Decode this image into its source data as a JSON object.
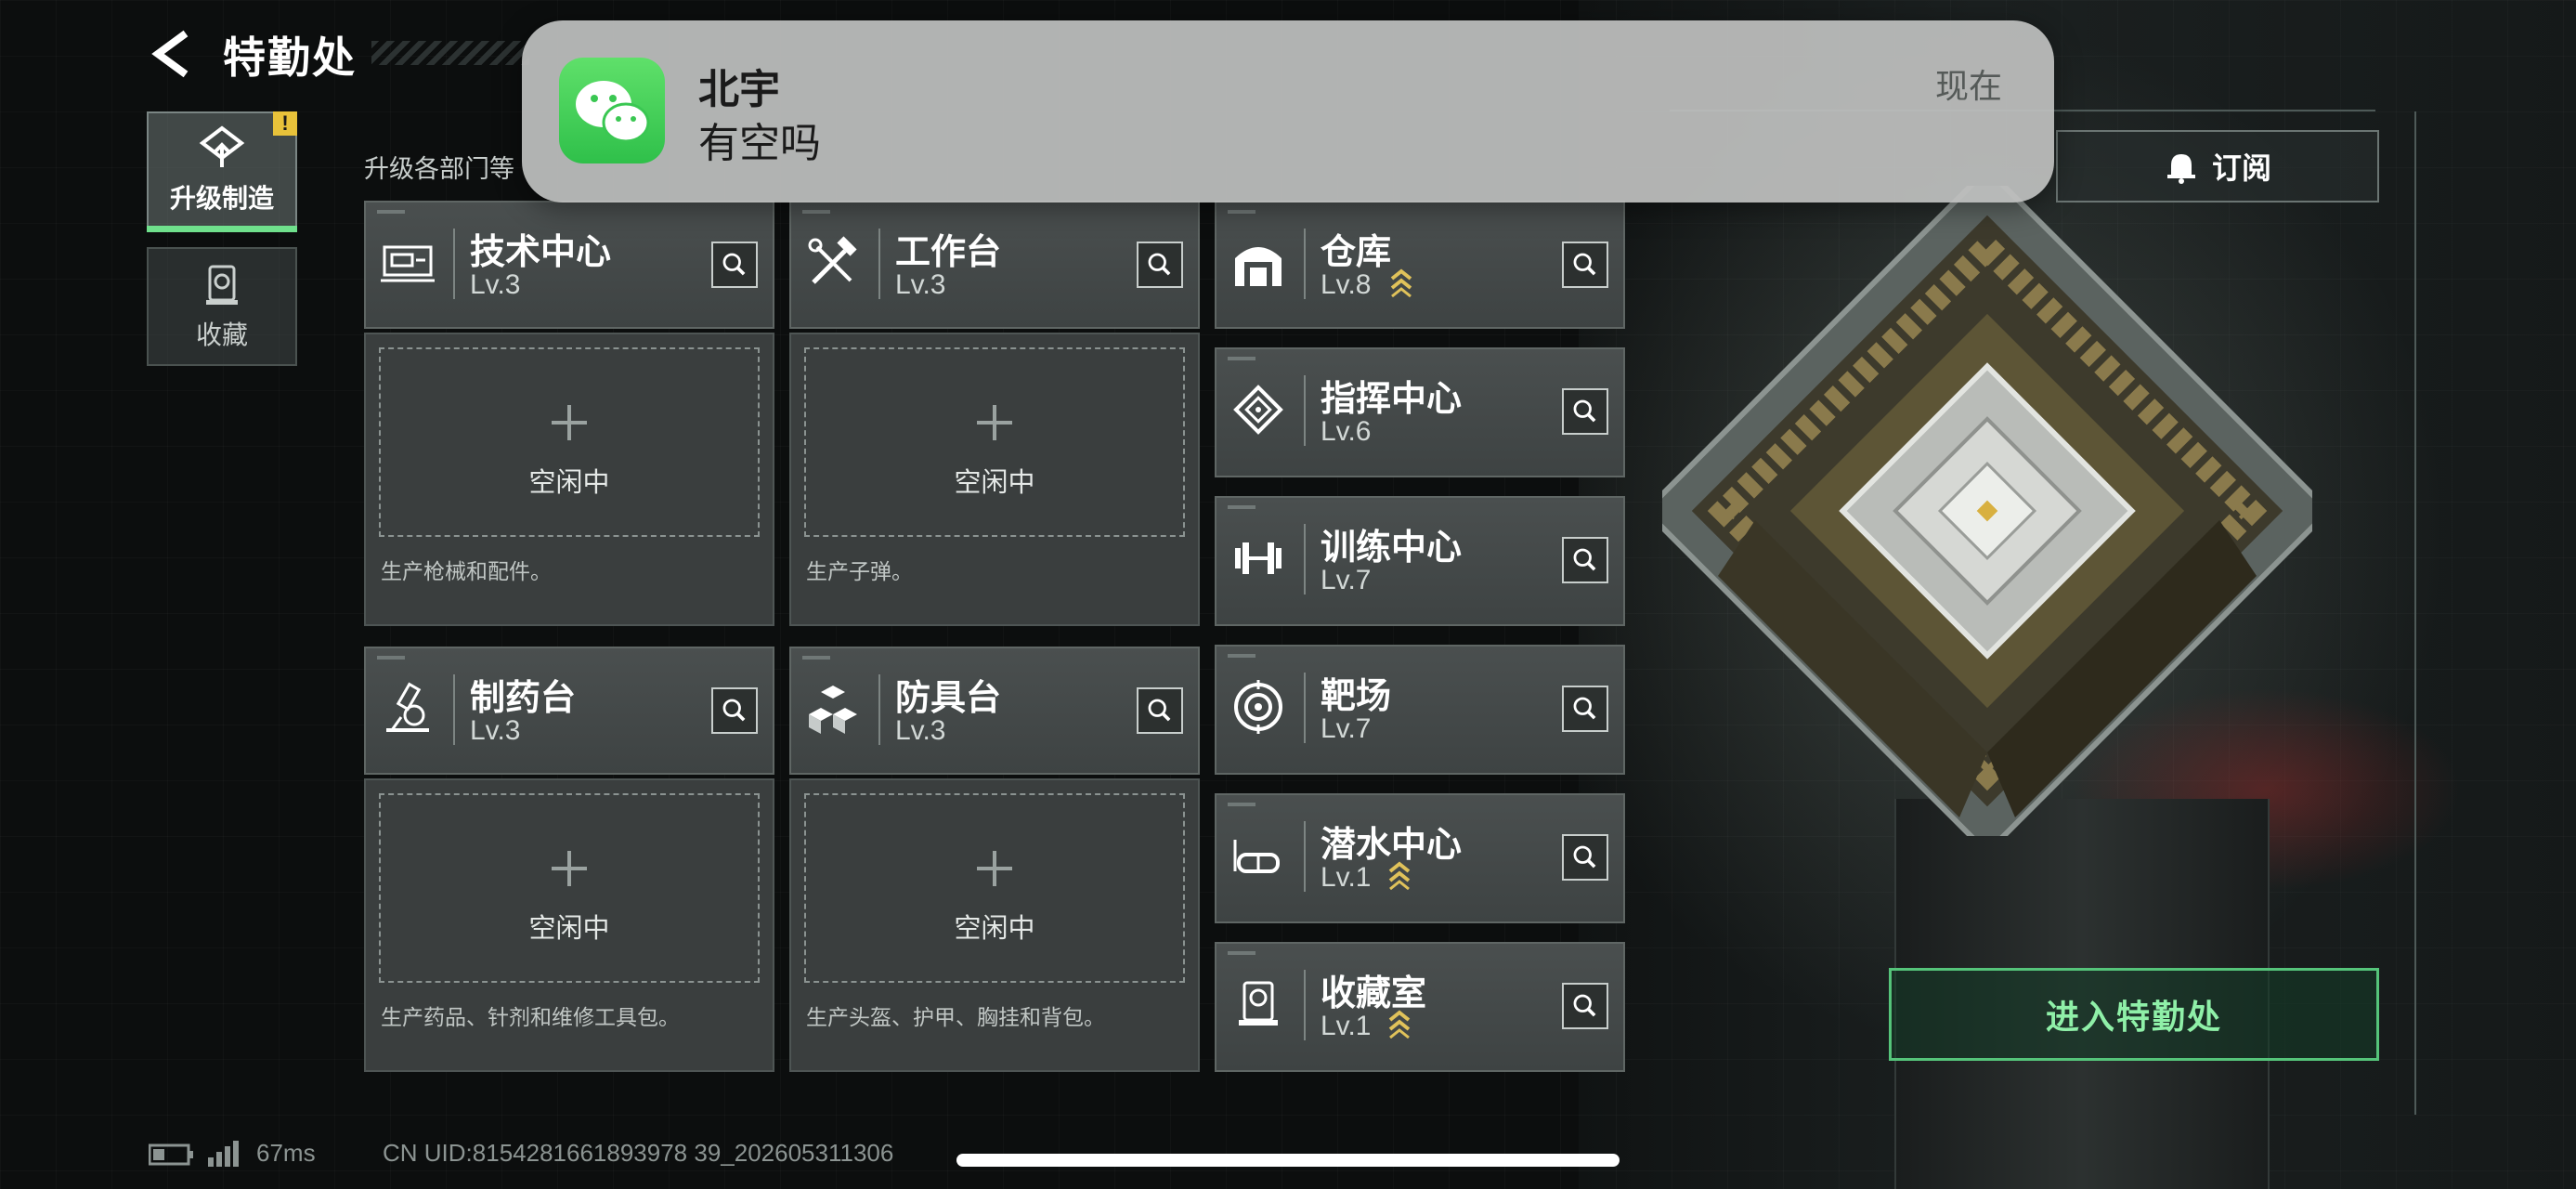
{
  "header": {
    "title": "特勤处"
  },
  "sidebar": {
    "tabs": [
      {
        "label": "升级制造",
        "icon": "upgrade-craft-icon",
        "active": true,
        "badge": "!"
      },
      {
        "label": "收藏",
        "icon": "collection-icon",
        "active": false
      }
    ]
  },
  "subtitle": "升级各部门等",
  "workshops": [
    {
      "name": "技术中心",
      "level": "Lv.3",
      "icon": "tech-center-icon",
      "slot_label": "空闲中",
      "desc": "生产枪械和配件。"
    },
    {
      "name": "工作台",
      "level": "Lv.3",
      "icon": "workbench-icon",
      "slot_label": "空闲中",
      "desc": "生产子弹。"
    },
    {
      "name": "制药台",
      "level": "Lv.3",
      "icon": "pharmacy-icon",
      "slot_label": "空闲中",
      "desc": "生产药品、针剂和维修工具包。"
    },
    {
      "name": "防具台",
      "level": "Lv.3",
      "icon": "armor-bench-icon",
      "slot_label": "空闲中",
      "desc": "生产头盔、护甲、胸挂和背包。"
    }
  ],
  "facilities": [
    {
      "name": "仓库",
      "level": "Lv.8",
      "icon": "warehouse-icon",
      "upgradable": true
    },
    {
      "name": "指挥中心",
      "level": "Lv.6",
      "icon": "command-center-icon",
      "upgradable": false
    },
    {
      "name": "训练中心",
      "level": "Lv.7",
      "icon": "training-center-icon",
      "upgradable": false
    },
    {
      "name": "靶场",
      "level": "Lv.7",
      "icon": "shooting-range-icon",
      "upgradable": false
    },
    {
      "name": "潜水中心",
      "level": "Lv.1",
      "icon": "diving-center-icon",
      "upgradable": true
    },
    {
      "name": "收藏室",
      "level": "Lv.1",
      "icon": "collection-room-icon",
      "upgradable": true
    }
  ],
  "subscribe_button": {
    "label": "订阅",
    "icon": "bell-icon"
  },
  "enter_button": {
    "label": "进入特勤处"
  },
  "status": {
    "ping": "67ms",
    "uid": "CN UID:8154281661893978 39_202605311306"
  },
  "notification": {
    "app": "WeChat",
    "sender": "北宇",
    "message": "有空吗",
    "time": "现在"
  },
  "colors": {
    "accent_green": "#55c47a",
    "badge_yellow": "#e8c23a",
    "card_bg": "#454a4a"
  }
}
